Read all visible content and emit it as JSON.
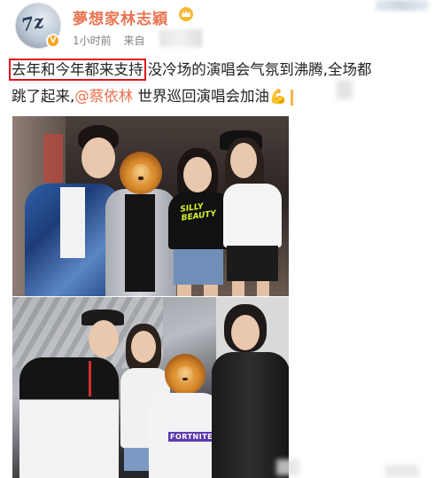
{
  "post": {
    "username": "夢想家林志穎",
    "verified_badge": "V",
    "crown_icon": "crown-icon",
    "time": "1小时前",
    "source_label": "来自",
    "text_segments": {
      "highlighted": "去年和今年都来支持",
      "line1_rest": ",没冷场的演唱会气氛到沸腾,全场都",
      "line2_start": "跳了起来,",
      "mention": "@蔡依林",
      "line2_rest": " 世界巡回演唱会加油",
      "emoji": "💪"
    },
    "photo1_shirt_print_line1": "SILLY",
    "photo1_shirt_print_line2": "BEAUTY",
    "photo2_shirt_print": "FORTNITE"
  },
  "colors": {
    "username": "#eb7350",
    "mention": "#eb7350",
    "highlight_box": "#e0141e",
    "meta_text": "#808080",
    "verified_badge": "#f5a623"
  }
}
